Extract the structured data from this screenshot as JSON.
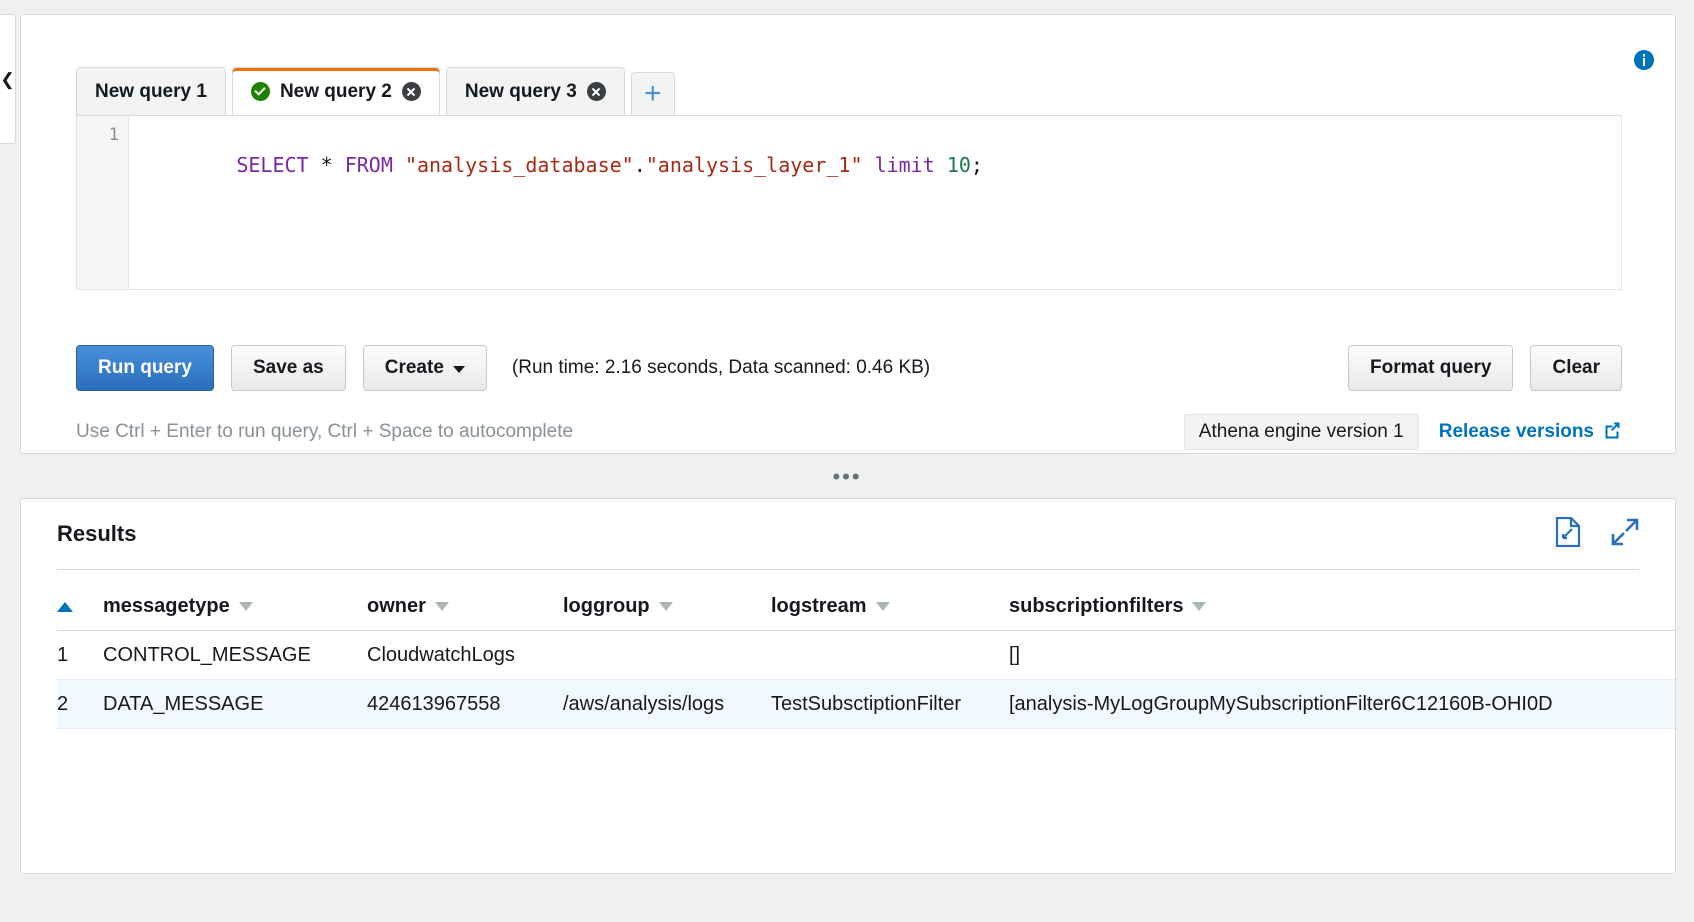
{
  "left_rail": {
    "collapse_icon": "chevron-left-icon"
  },
  "editor": {
    "info_icon": "info-icon",
    "tabs": [
      {
        "label": "New query 1",
        "active": false,
        "has_status": false,
        "closable": false
      },
      {
        "label": "New query 2",
        "active": true,
        "has_status": true,
        "closable": true
      },
      {
        "label": "New query 3",
        "active": false,
        "has_status": false,
        "closable": true
      }
    ],
    "add_tab_label": "+",
    "line_number": "1",
    "query_tokens": [
      {
        "text": "SELECT",
        "type": "kw"
      },
      {
        "text": " ",
        "type": "pun"
      },
      {
        "text": "*",
        "type": "op"
      },
      {
        "text": " ",
        "type": "pun"
      },
      {
        "text": "FROM",
        "type": "kw"
      },
      {
        "text": " ",
        "type": "pun"
      },
      {
        "text": "\"analysis_database\"",
        "type": "str"
      },
      {
        "text": ".",
        "type": "pun"
      },
      {
        "text": "\"analysis_layer_1\"",
        "type": "str"
      },
      {
        "text": " ",
        "type": "pun"
      },
      {
        "text": "limit",
        "type": "kw"
      },
      {
        "text": " ",
        "type": "pun"
      },
      {
        "text": "10",
        "type": "num"
      },
      {
        "text": ";",
        "type": "pun"
      }
    ],
    "query_text": "SELECT * FROM \"analysis_database\".\"analysis_layer_1\" limit 10;"
  },
  "actions": {
    "run_query": "Run query",
    "save_as": "Save as",
    "create": "Create",
    "create_caret_icon": "chevron-down-icon",
    "run_stats": "(Run time: 2.16 seconds, Data scanned: 0.46 KB)",
    "format_query": "Format query",
    "clear": "Clear"
  },
  "hints": {
    "shortcut_text": "Use Ctrl + Enter to run query, Ctrl + Space to autocomplete",
    "engine_version": "Athena engine version 1",
    "release_versions": "Release versions",
    "external_link_icon": "external-link-icon"
  },
  "splitter": {
    "handle": "•••"
  },
  "results": {
    "title": "Results",
    "download_icon": "download-file-icon",
    "expand_icon": "expand-icon",
    "sort_indicator_icon": "sort-ascending-icon",
    "columns": [
      {
        "label": "messagetype",
        "caret_icon": "chevron-down-icon"
      },
      {
        "label": "owner",
        "caret_icon": "chevron-down-icon"
      },
      {
        "label": "loggroup",
        "caret_icon": "chevron-down-icon"
      },
      {
        "label": "logstream",
        "caret_icon": "chevron-down-icon"
      },
      {
        "label": "subscriptionfilters",
        "caret_icon": "chevron-down-icon"
      }
    ],
    "rows": [
      {
        "index": "1",
        "messagetype": "CONTROL_MESSAGE",
        "owner": "CloudwatchLogs",
        "loggroup": "",
        "logstream": "",
        "subscriptionfilters": "[]"
      },
      {
        "index": "2",
        "messagetype": "DATA_MESSAGE",
        "owner": "424613967558",
        "loggroup": "/aws/analysis/logs",
        "logstream": "TestSubsctiptionFilter",
        "subscriptionfilters": "[analysis-MyLogGroupMySubscriptionFilter6C12160B-OHI0D"
      }
    ]
  },
  "colors": {
    "accent_blue": "#0073bb",
    "primary_button": "#2a6ebb",
    "active_tab_top": "#ec7211",
    "status_green": "#1d8102",
    "row_highlight": "#f1f8fe"
  }
}
